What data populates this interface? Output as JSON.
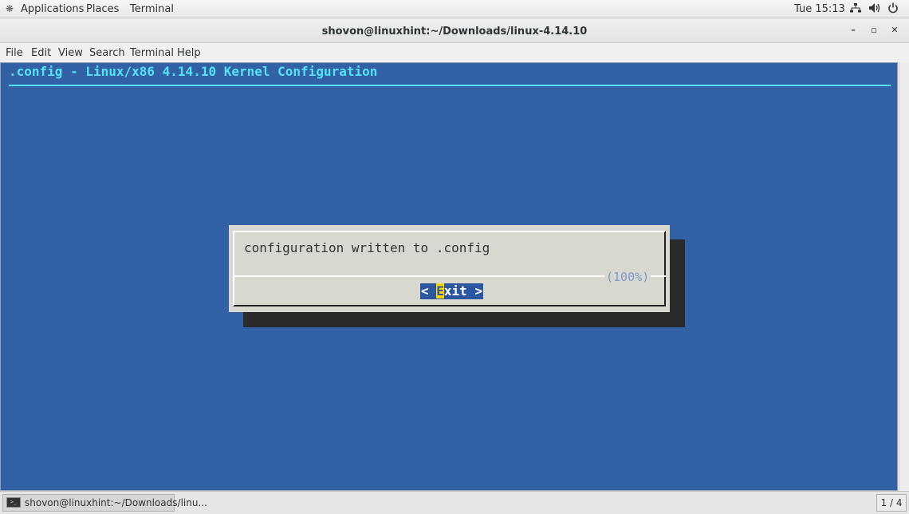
{
  "topbar": {
    "applications": "Applications",
    "places": "Places",
    "terminal": "Terminal",
    "clock": "Tue 15:13",
    "icons": [
      "network-icon",
      "volume-icon",
      "power-icon"
    ]
  },
  "window": {
    "title": "shovon@linuxhint:~/Downloads/linux-4.14.10",
    "minimize": "–",
    "maximize": "▫",
    "close": "✕"
  },
  "menubar": [
    "File",
    "Edit",
    "View",
    "Search",
    "Terminal",
    "Help"
  ],
  "terminal": {
    "heading": ".config - Linux/x86 4.14.10 Kernel Configuration",
    "background_color": "#3361a6",
    "heading_color": "#56e3f5",
    "dialog": {
      "message": "configuration written to .config",
      "progress": "(100%)",
      "exit_prefix": "< ",
      "exit_hotkey": "E",
      "exit_rest": "xit >"
    }
  },
  "taskbar": {
    "task_label": "shovon@linuxhint:~/Downloads/linu...",
    "workspace": "1 / 4"
  }
}
